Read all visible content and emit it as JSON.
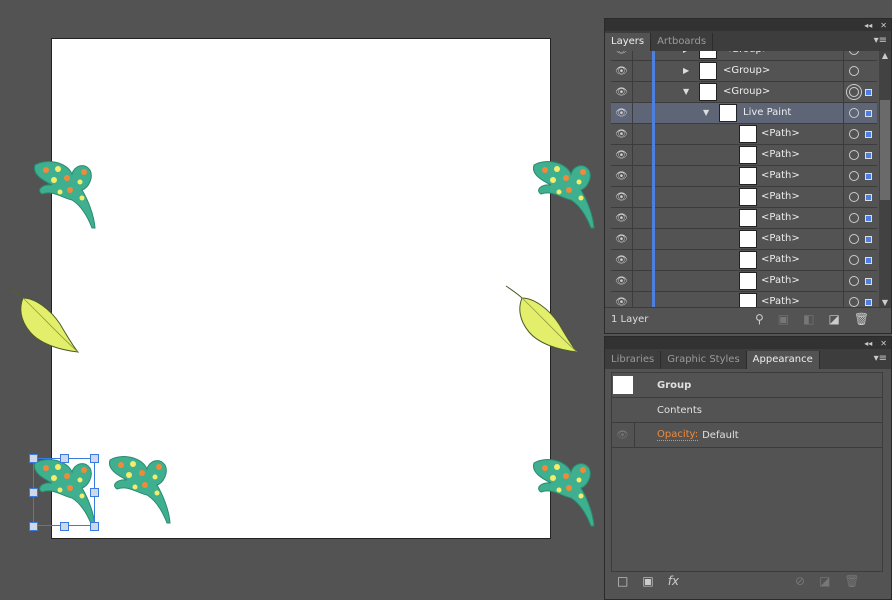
{
  "layers_panel": {
    "tabs": [
      {
        "label": "Layers",
        "active": true
      },
      {
        "label": "Artboards",
        "active": false
      }
    ],
    "rows": [
      {
        "label": "<Group>",
        "expand": "collapsed",
        "depth": 1,
        "partial": true
      },
      {
        "label": "<Group>",
        "expand": "collapsed",
        "depth": 1
      },
      {
        "label": "<Group>",
        "expand": "expanded",
        "depth": 1,
        "targeted": true
      },
      {
        "label": "Live Paint",
        "expand": "expanded",
        "depth": 2,
        "selected": true
      },
      {
        "label": "<Path>",
        "depth": 3
      },
      {
        "label": "<Path>",
        "depth": 3
      },
      {
        "label": "<Path>",
        "depth": 3
      },
      {
        "label": "<Path>",
        "depth": 3
      },
      {
        "label": "<Path>",
        "depth": 3
      },
      {
        "label": "<Path>",
        "depth": 3
      },
      {
        "label": "<Path>",
        "depth": 3
      },
      {
        "label": "<Path>",
        "depth": 3
      },
      {
        "label": "<Path>",
        "depth": 3,
        "partial": true
      }
    ],
    "footer_count": "1 Layer",
    "layer_color": "#4d7fe0"
  },
  "appearance_panel": {
    "tabs": [
      {
        "label": "Libraries",
        "active": false
      },
      {
        "label": "Graphic Styles",
        "active": false
      },
      {
        "label": "Appearance",
        "active": true
      }
    ],
    "object": "Group",
    "contents": "Contents",
    "opacity_label": "Opacity:",
    "opacity_value": "Default",
    "fx_label": "fx"
  },
  "colors": {
    "leaf_green": "#3fb08f",
    "leaf_yellow": "#e3ef6a",
    "spot_orange": "#f08a3a",
    "spot_yellow": "#f4ec6a",
    "selection": "#3a7be0"
  }
}
